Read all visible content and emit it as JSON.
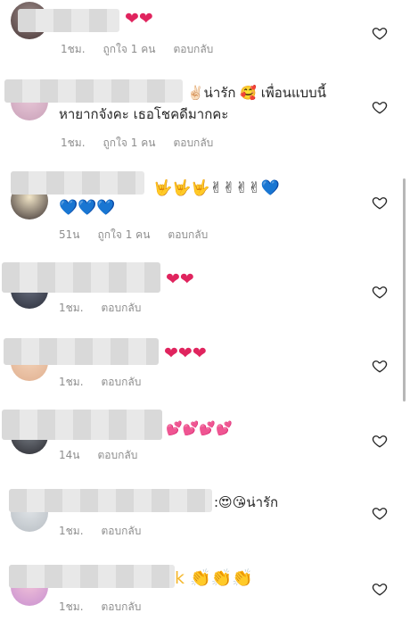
{
  "comments": [
    {
      "id": "c1",
      "text": "❤❤",
      "time": "1ชม.",
      "likes": "ถูกใจ 1 คน",
      "reply": "ตอบกลับ"
    },
    {
      "id": "c2",
      "text_line1": "✌🏻น่ารัก 🥰 เพื่อนแบบนี้",
      "text_line2": "หายากจังคะ เธอโชคดีมากคะ",
      "time": "1ชม.",
      "likes": "ถูกใจ 1 คน",
      "reply": "ตอบกลับ"
    },
    {
      "id": "c3",
      "text_line1": "🤟🤟🤟✌✌✌✌💙",
      "text_line2": "💙💙💙",
      "time": "51น",
      "likes": "ถูกใจ 1 คน",
      "reply": "ตอบกลับ"
    },
    {
      "id": "c4",
      "text": "❤❤",
      "time": "1ชม.",
      "reply": "ตอบกลับ"
    },
    {
      "id": "c5",
      "text": "❤❤❤",
      "time": "1ชม.",
      "reply": "ตอบกลับ"
    },
    {
      "id": "c6",
      "text": "💕💕💕💕",
      "time": "14น",
      "reply": "ตอบกลับ"
    },
    {
      "id": "c7",
      "text": ":😍😘น่ารัก",
      "time": "1ชม.",
      "reply": "ตอบกลับ"
    },
    {
      "id": "c8",
      "text": "k 👏👏👏",
      "time": "1ชม.",
      "reply": "ตอบกลับ"
    }
  ],
  "icons": {
    "like": "heart-outline-icon"
  },
  "colors": {
    "meta_text": "#8e8e8e",
    "body_text": "#262626",
    "heart_red": "#e0245e",
    "heart_blue": "#2f7ce8",
    "heart_pink": "#e84393"
  }
}
